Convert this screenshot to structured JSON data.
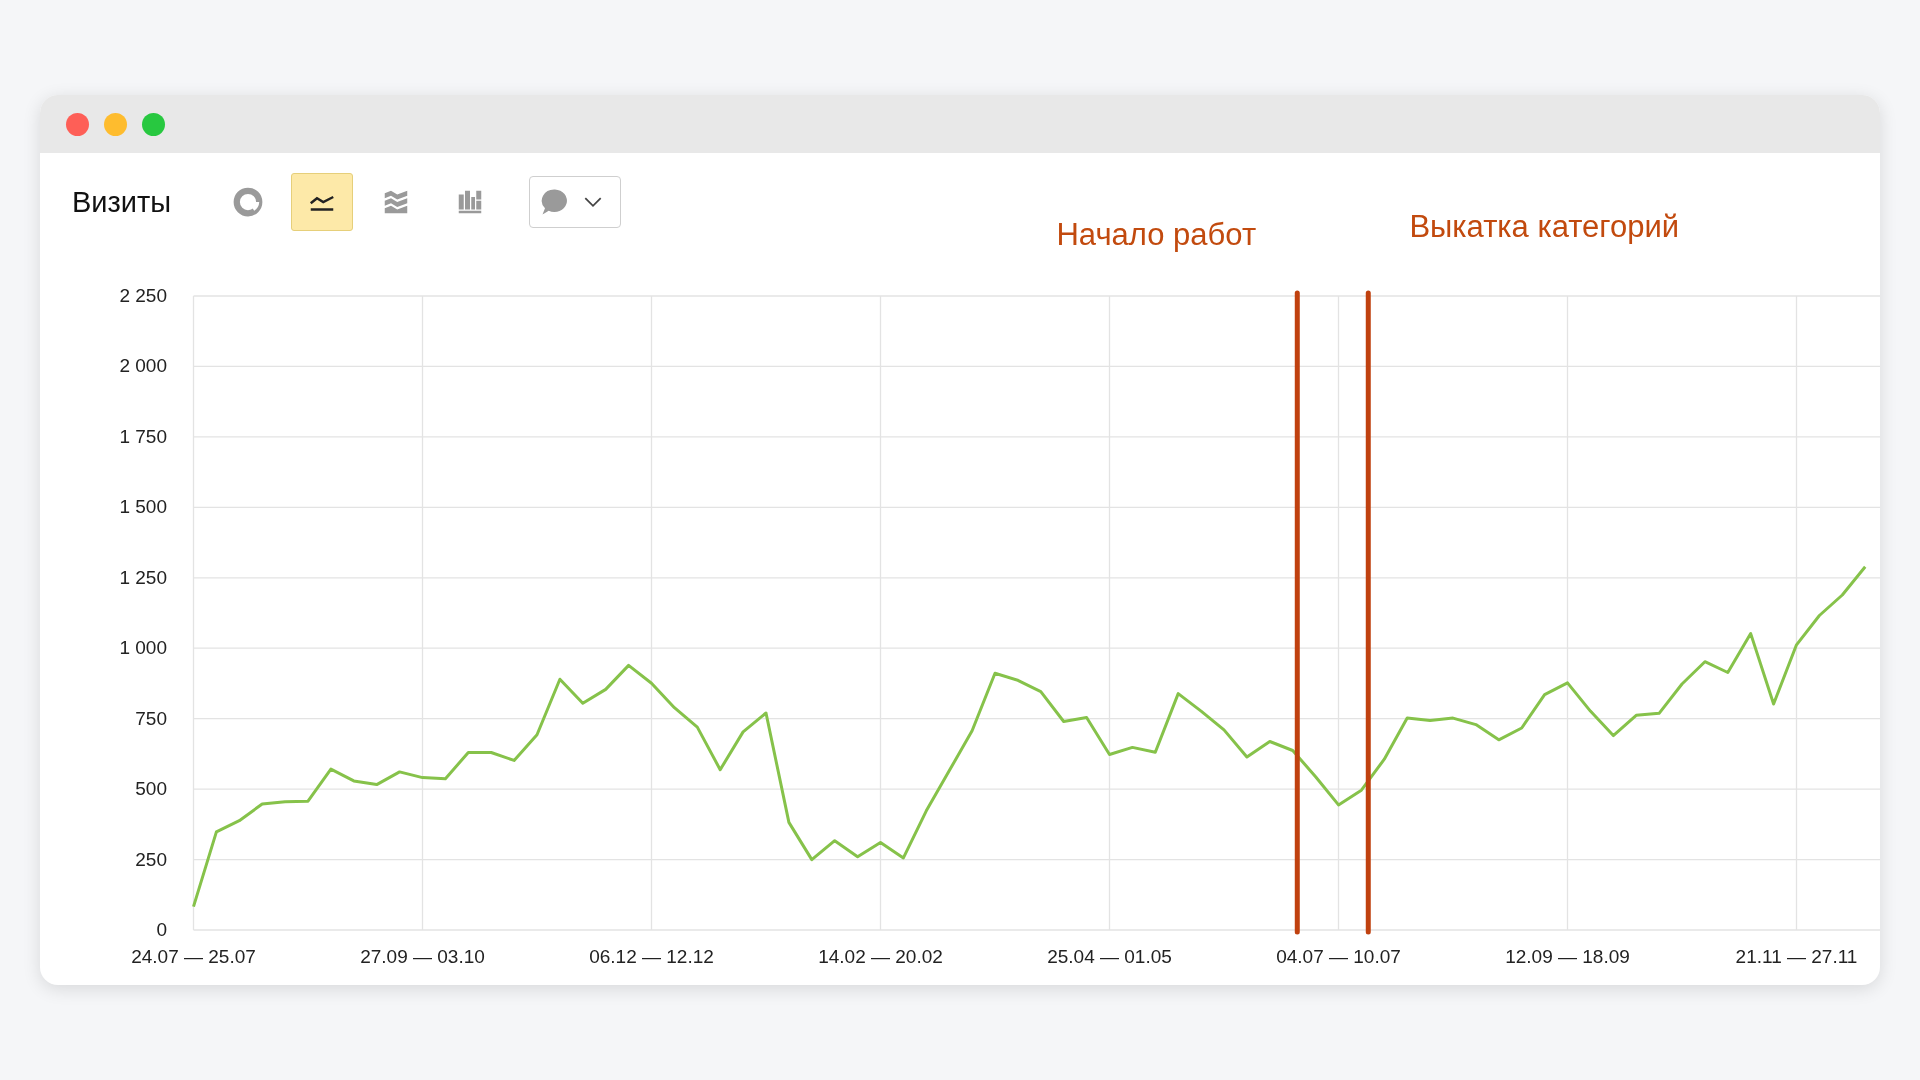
{
  "toolbar": {
    "title": "Визиты",
    "chart_types": [
      {
        "kind": "pie",
        "selected": false
      },
      {
        "kind": "line",
        "selected": true
      },
      {
        "kind": "area",
        "selected": false
      },
      {
        "kind": "bar",
        "selected": false
      }
    ]
  },
  "chart": {
    "chart_data": {
      "type": "line",
      "categories": [
        "24.07 — 25.07",
        null,
        null,
        null,
        null,
        null,
        null,
        null,
        null,
        null,
        "27.09 — 03.10",
        null,
        null,
        null,
        null,
        null,
        null,
        null,
        null,
        null,
        "06.12 — 12.12",
        null,
        null,
        null,
        null,
        null,
        null,
        null,
        null,
        null,
        "14.02 — 20.02",
        null,
        null,
        null,
        null,
        null,
        null,
        null,
        null,
        null,
        "25.04 — 01.05",
        null,
        null,
        null,
        null,
        null,
        null,
        null,
        null,
        null,
        "04.07 — 10.07",
        null,
        null,
        null,
        null,
        null,
        null,
        null,
        null,
        null,
        "12.09 — 18.09",
        null,
        null,
        null,
        null,
        null,
        null,
        null,
        null,
        null,
        "21.11 — 27.11",
        null,
        null,
        null
      ],
      "series": [
        {
          "color": "#86c24a",
          "values": [
            83,
            348,
            388,
            447,
            455,
            457,
            571,
            529,
            516,
            561,
            541,
            537,
            630,
            630,
            602,
            693,
            890,
            805,
            854,
            939,
            876,
            789,
            720,
            569,
            703,
            770,
            382,
            250,
            317,
            260,
            311,
            256,
            423,
            565,
            707,
            911,
            886,
            846,
            740,
            754,
            623,
            648,
            631,
            839,
            777,
            710,
            614,
            669,
            637,
            544,
            444,
            496,
            606,
            752,
            744,
            752,
            729,
            675,
            717,
            835,
            877,
            777,
            690,
            762,
            769,
            873,
            952,
            914,
            1052,
            802,
            1012,
            1116,
            1189,
            1289
          ]
        }
      ],
      "grid": true,
      "ylim": [
        0,
        2250
      ],
      "yticks": [
        {
          "value": 0,
          "label": "0"
        },
        {
          "value": 250,
          "label": "250"
        },
        {
          "value": 500,
          "label": "500"
        },
        {
          "value": 750,
          "label": "750"
        },
        {
          "value": 1000,
          "label": "1 000"
        },
        {
          "value": 1250,
          "label": "1 250"
        },
        {
          "value": 1500,
          "label": "1 500"
        },
        {
          "value": 1750,
          "label": "1 750"
        },
        {
          "value": 2000,
          "label": "2 000"
        },
        {
          "value": 2250,
          "label": "2 250"
        }
      ],
      "annotations": [
        "Начало работ",
        "Выкатка категорий"
      ]
    }
  }
}
